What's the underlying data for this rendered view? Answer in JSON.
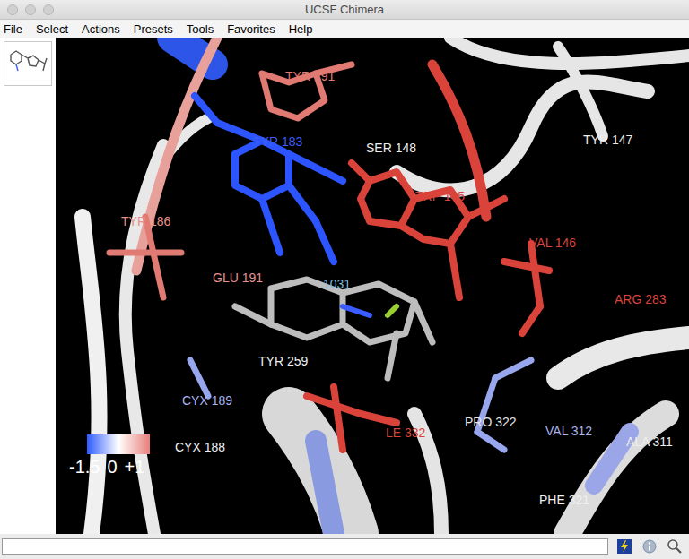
{
  "window": {
    "title": "UCSF Chimera"
  },
  "menu": [
    "File",
    "Select",
    "Actions",
    "Presets",
    "Tools",
    "Favorites",
    "Help"
  ],
  "viewer": {
    "labels": [
      {
        "text": "TYR 191",
        "color": "#e07a72"
      },
      {
        "text": "TYR 183",
        "color": "#3b5cff"
      },
      {
        "text": "SER 148",
        "color": "#eeeeee"
      },
      {
        "text": "TRP 145",
        "color": "#d9433a"
      },
      {
        "text": "TYR 147",
        "color": "#eeeeee"
      },
      {
        "text": "TYR 186",
        "color": "#e8918b"
      },
      {
        "text": "VAL 146",
        "color": "#d9433a"
      },
      {
        "text": "GLU 191",
        "color": "#e8918b"
      },
      {
        "text": "1031",
        "color": "#7fb8d8"
      },
      {
        "text": "ARG 283",
        "color": "#d9433a"
      },
      {
        "text": "TYR 259",
        "color": "#eeeeee"
      },
      {
        "text": "CYX 189",
        "color": "#aab2ee"
      },
      {
        "text": "PRO 322",
        "color": "#e6e6e6"
      },
      {
        "text": "VAL 312",
        "color": "#aab2ee"
      },
      {
        "text": "LE 332",
        "color": "#d9433a"
      },
      {
        "text": "CYX 188",
        "color": "#f0f0f0"
      },
      {
        "text": "ALA 311",
        "color": "#eeeeee"
      },
      {
        "text": "PHE 321",
        "color": "#eeeeee"
      }
    ],
    "color_key": {
      "labels": [
        "-1.5",
        "0",
        "+1"
      ],
      "colors": [
        "#2d5cff",
        "#ffffff",
        "#e8807a"
      ]
    }
  },
  "command_line": {
    "value": ""
  }
}
